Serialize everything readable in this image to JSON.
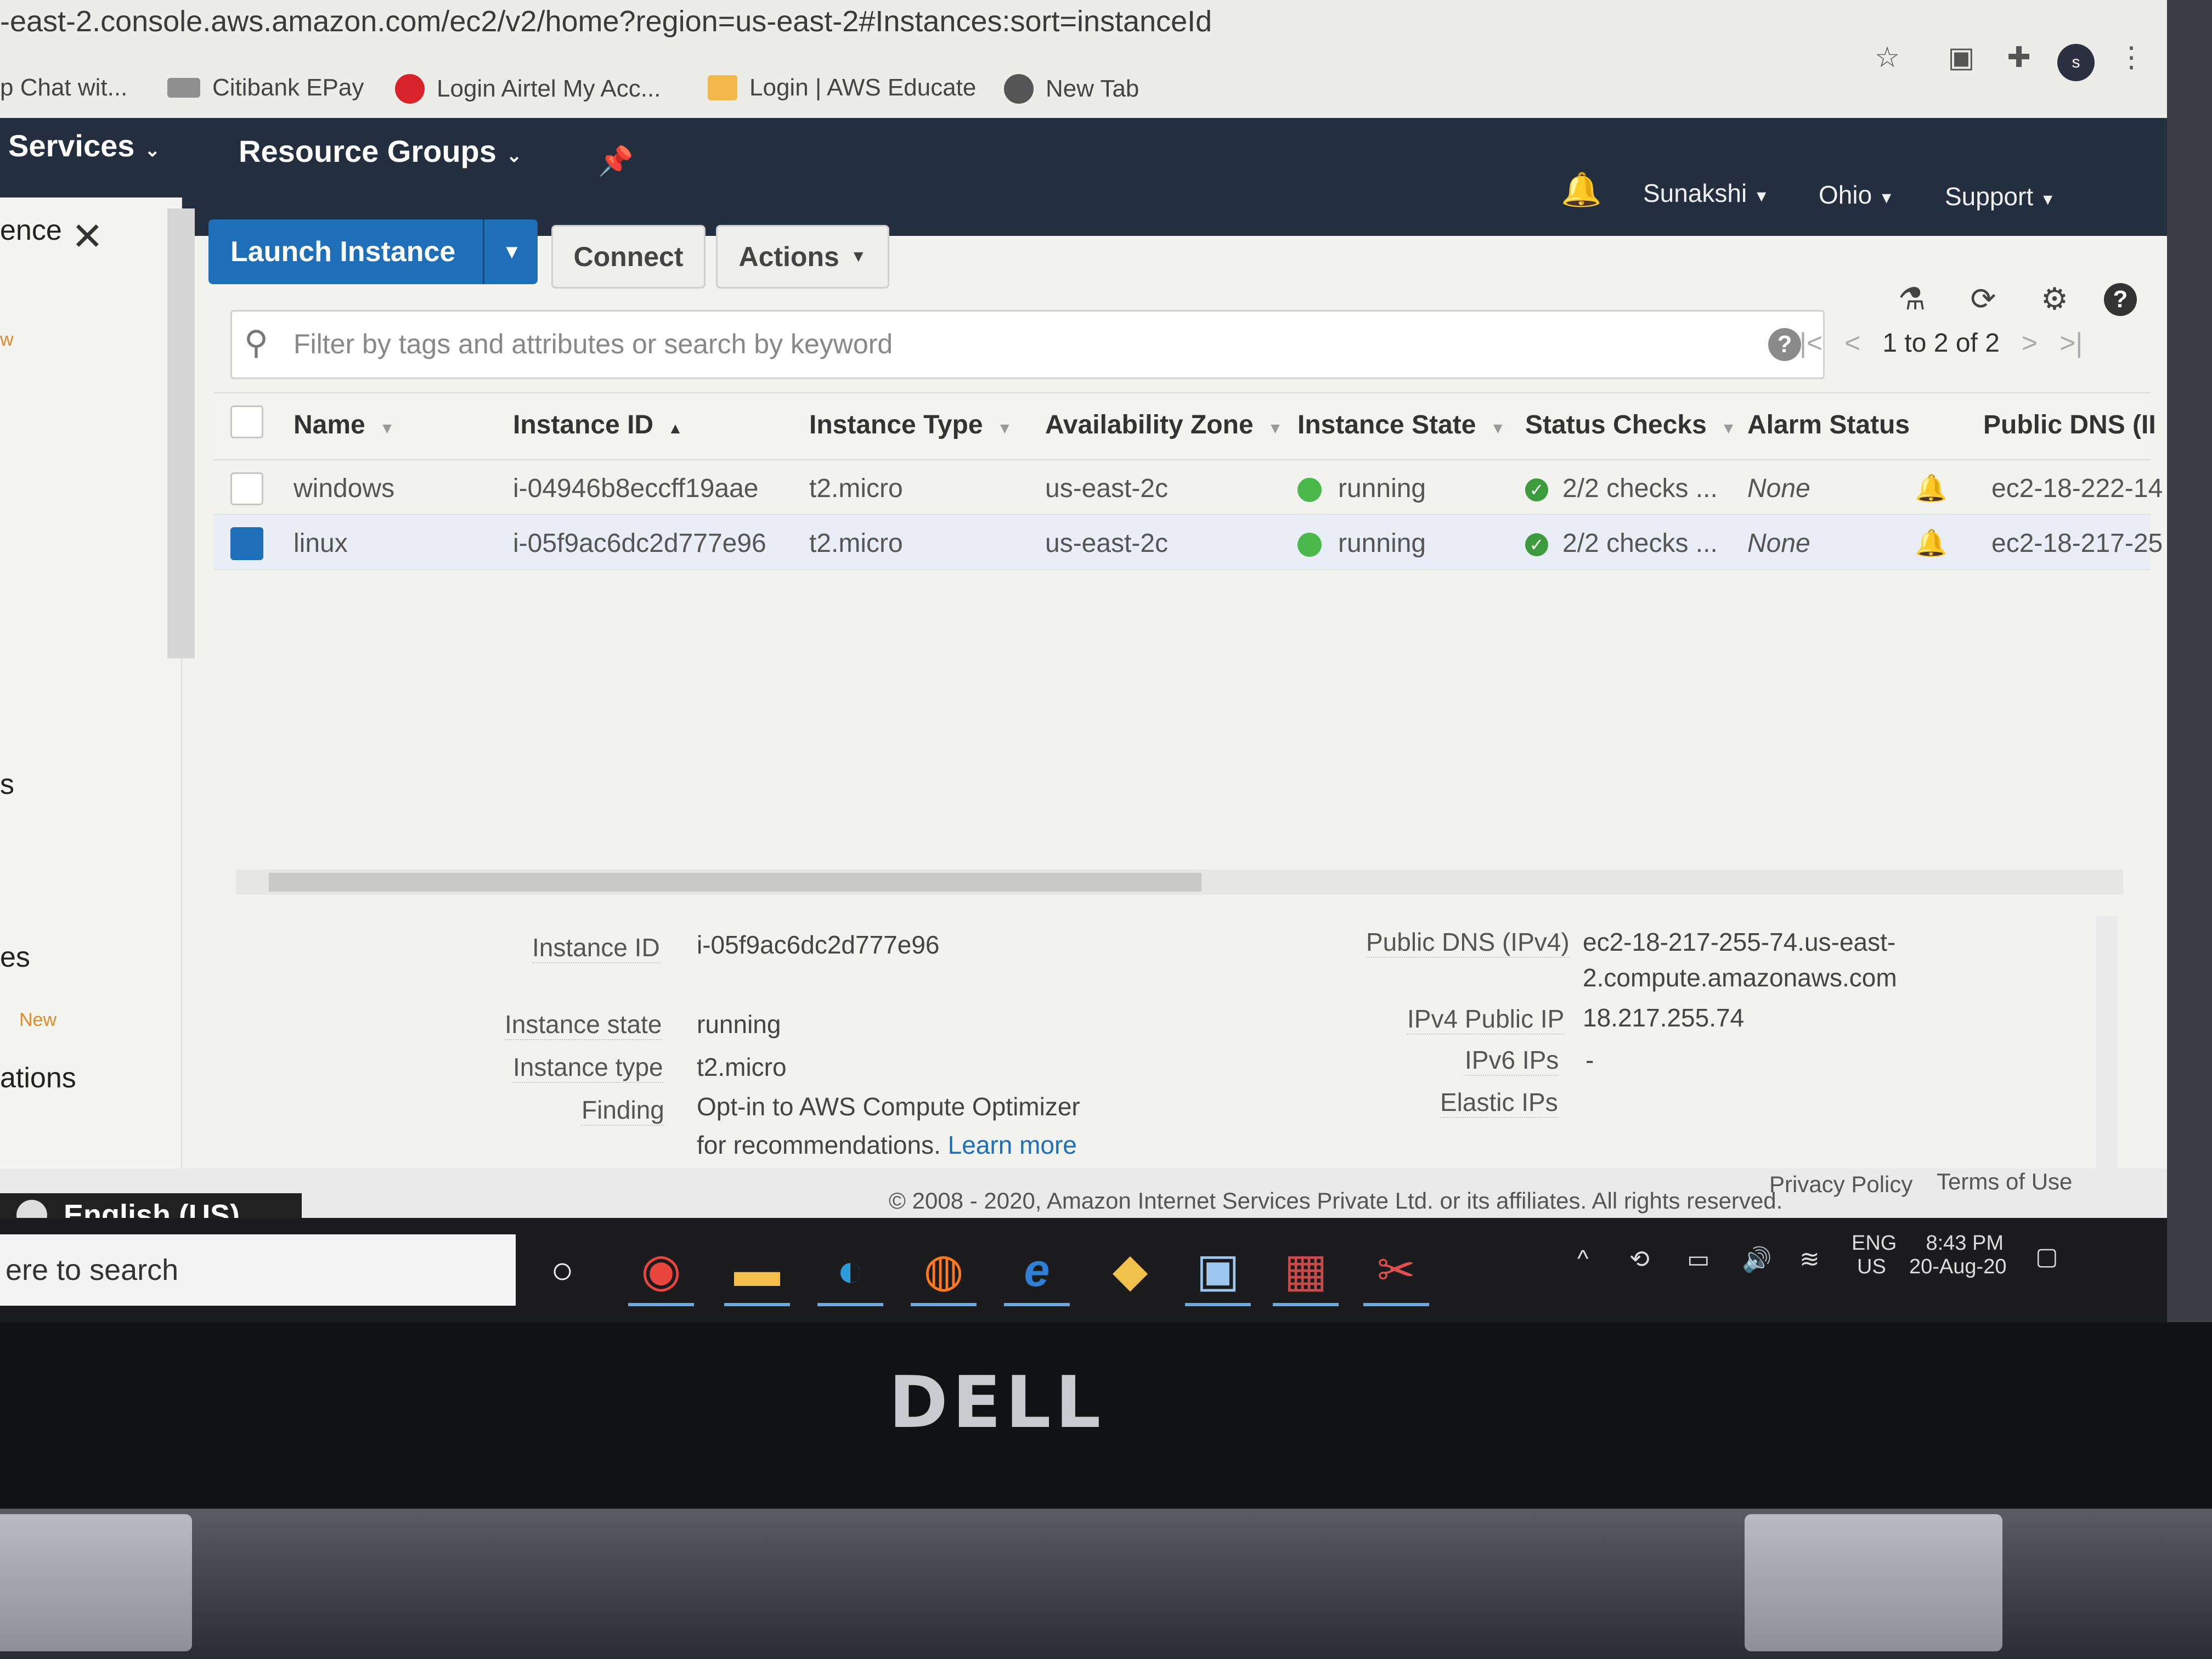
{
  "browser": {
    "url": "-east-2.console.aws.amazon.com/ec2/v2/home?region=us-east-2#Instances:sort=instanceId",
    "bookmarks": [
      {
        "label": "p Chat wit..."
      },
      {
        "label": "Citibank EPay"
      },
      {
        "label": "Login Airtel My Acc..."
      },
      {
        "label": "Login | AWS Educate"
      },
      {
        "label": "New Tab"
      }
    ],
    "profile_initial": "s"
  },
  "nav": {
    "services": "Services",
    "resource_groups": "Resource Groups",
    "user": "Sunakshi",
    "region": "Ohio",
    "support": "Support"
  },
  "sidebar": {
    "top_label": "ence",
    "partial_w": "w",
    "partial_s": "s",
    "partial_es": "es",
    "new_badge": "New",
    "partial_ations": "ations"
  },
  "toolbar": {
    "launch": "Launch Instance",
    "connect": "Connect",
    "actions": "Actions"
  },
  "search": {
    "placeholder": "Filter by tags and attributes or search by keyword"
  },
  "pager": {
    "text": "1 to 2 of 2"
  },
  "table": {
    "columns": [
      "Name",
      "Instance ID",
      "Instance Type",
      "Availability Zone",
      "Instance State",
      "Status Checks",
      "Alarm Status",
      "Public DNS (II"
    ],
    "rows": [
      {
        "name": "windows",
        "id": "i-04946b8eccff19aae",
        "type": "t2.micro",
        "az": "us-east-2c",
        "state": "running",
        "checks": "2/2 checks ...",
        "alarm": "None",
        "dns": "ec2-18-222-14",
        "selected": false
      },
      {
        "name": "linux",
        "id": "i-05f9ac6dc2d777e96",
        "type": "t2.micro",
        "az": "us-east-2c",
        "state": "running",
        "checks": "2/2 checks ...",
        "alarm": "None",
        "dns": "ec2-18-217-25",
        "selected": true
      }
    ]
  },
  "details": {
    "instance_id_label": "Instance ID",
    "instance_id": "i-05f9ac6dc2d777e96",
    "state_label": "Instance state",
    "state": "running",
    "type_label": "Instance type",
    "type": "t2.micro",
    "finding_label": "Finding",
    "finding_line1": "Opt-in to AWS Compute Optimizer",
    "finding_line2": "for recommendations.",
    "learn_more": "Learn more",
    "dns_label": "Public DNS (IPv4)",
    "dns_line1": "ec2-18-217-255-74.us-east-",
    "dns_line2": "2.compute.amazonaws.com",
    "ipv4_label": "IPv4 Public IP",
    "ipv4": "18.217.255.74",
    "ipv6_label": "IPv6 IPs",
    "ipv6": "-",
    "elastic_label": "Elastic IPs"
  },
  "footer": {
    "copyright": "© 2008 - 2020, Amazon Internet Services Private Ltd. or its affiliates. All rights reserved.",
    "privacy": "Privacy Policy",
    "terms": "Terms of Use"
  },
  "language": "English (US)",
  "taskbar": {
    "search_text": "ere to search",
    "lang_line1": "ENG",
    "lang_line2": "US",
    "time": "8:43 PM",
    "date": "20-Aug-20"
  },
  "brand": "DELL",
  "colors": {
    "aws_nav": "#232f3e",
    "primary_button": "#1f6fb8",
    "running": "#4ab84a"
  }
}
